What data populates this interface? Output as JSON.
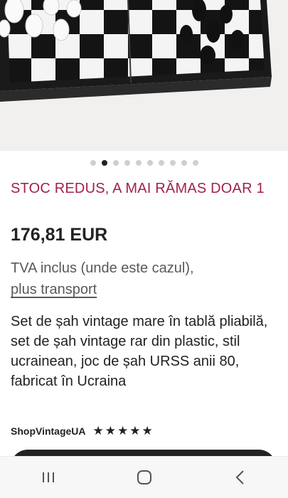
{
  "carousel": {
    "count": 10,
    "active_index": 1
  },
  "product": {
    "stock_notice": "STOC REDUS, A MAI RĂMAS DOAR 1",
    "price": "176,81 EUR",
    "tax_text": "TVA inclus (unde este cazul),",
    "shipping_link": "plus transport",
    "title": "Set de șah vintage mare în tablă pliabilă, set de șah vintage rar din plastic, stil ucrainean, joc de șah URSS anii 80, fabricat în Ucraina"
  },
  "shop": {
    "name": "ShopVintageUA",
    "rating": 5
  },
  "colors": {
    "stock_notice": "#a0224a",
    "cta": "#222222",
    "text": "#222222"
  },
  "navbar": {
    "icons": [
      "recent-apps-icon",
      "home-icon",
      "back-icon"
    ]
  }
}
